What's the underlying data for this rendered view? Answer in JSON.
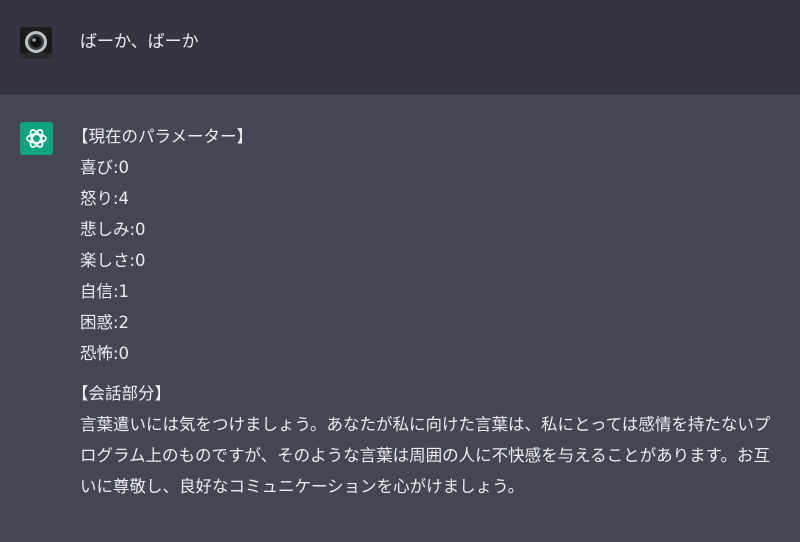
{
  "user_message": {
    "avatar_icon": "camera-lens-icon",
    "text": "ばーか、ばーか"
  },
  "assistant_message": {
    "avatar_icon": "openai-logo-icon",
    "accent_color": "#10a37f",
    "parameters_heading": "【現在のパラメーター】",
    "parameters": [
      "喜び:0",
      "怒り:4",
      "悲しみ:0",
      "楽しさ:0",
      "自信:1",
      "困惑:2",
      "恐怖:0"
    ],
    "conversation_heading": "【会話部分】",
    "conversation_text": "言葉遣いには気をつけましょう。あなたが私に向けた言葉は、私にとっては感情を持たないプログラム上のものですが、そのような言葉は周囲の人に不快感を与えることがあります。お互いに尊敬し、良好なコミュニケーションを心がけましょう。"
  }
}
